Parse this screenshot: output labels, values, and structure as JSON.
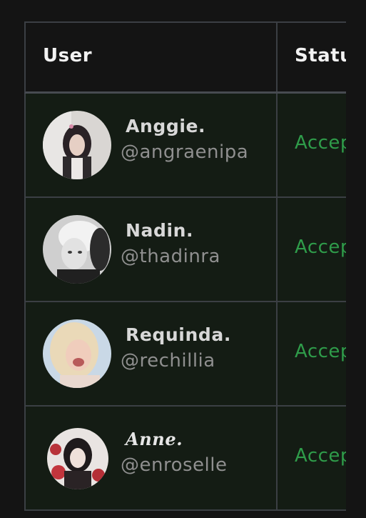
{
  "table": {
    "headers": {
      "user": "User",
      "status": "Status"
    },
    "status_color": "#2f9c4a",
    "rows": [
      {
        "name": "Anggie.",
        "handle": "@angraenipa",
        "status": "Accepted",
        "avatar_icon": "avatar-photo"
      },
      {
        "name": "Nadin.",
        "handle": "@thadinra",
        "status": "Accepted",
        "avatar_icon": "avatar-photo"
      },
      {
        "name": "Requinda.",
        "handle": "@rechillia",
        "status": "Accepted",
        "avatar_icon": "avatar-photo"
      },
      {
        "name": "Anne.",
        "handle": "@enroselle",
        "status": "Accepted",
        "avatar_icon": "avatar-photo"
      }
    ]
  }
}
